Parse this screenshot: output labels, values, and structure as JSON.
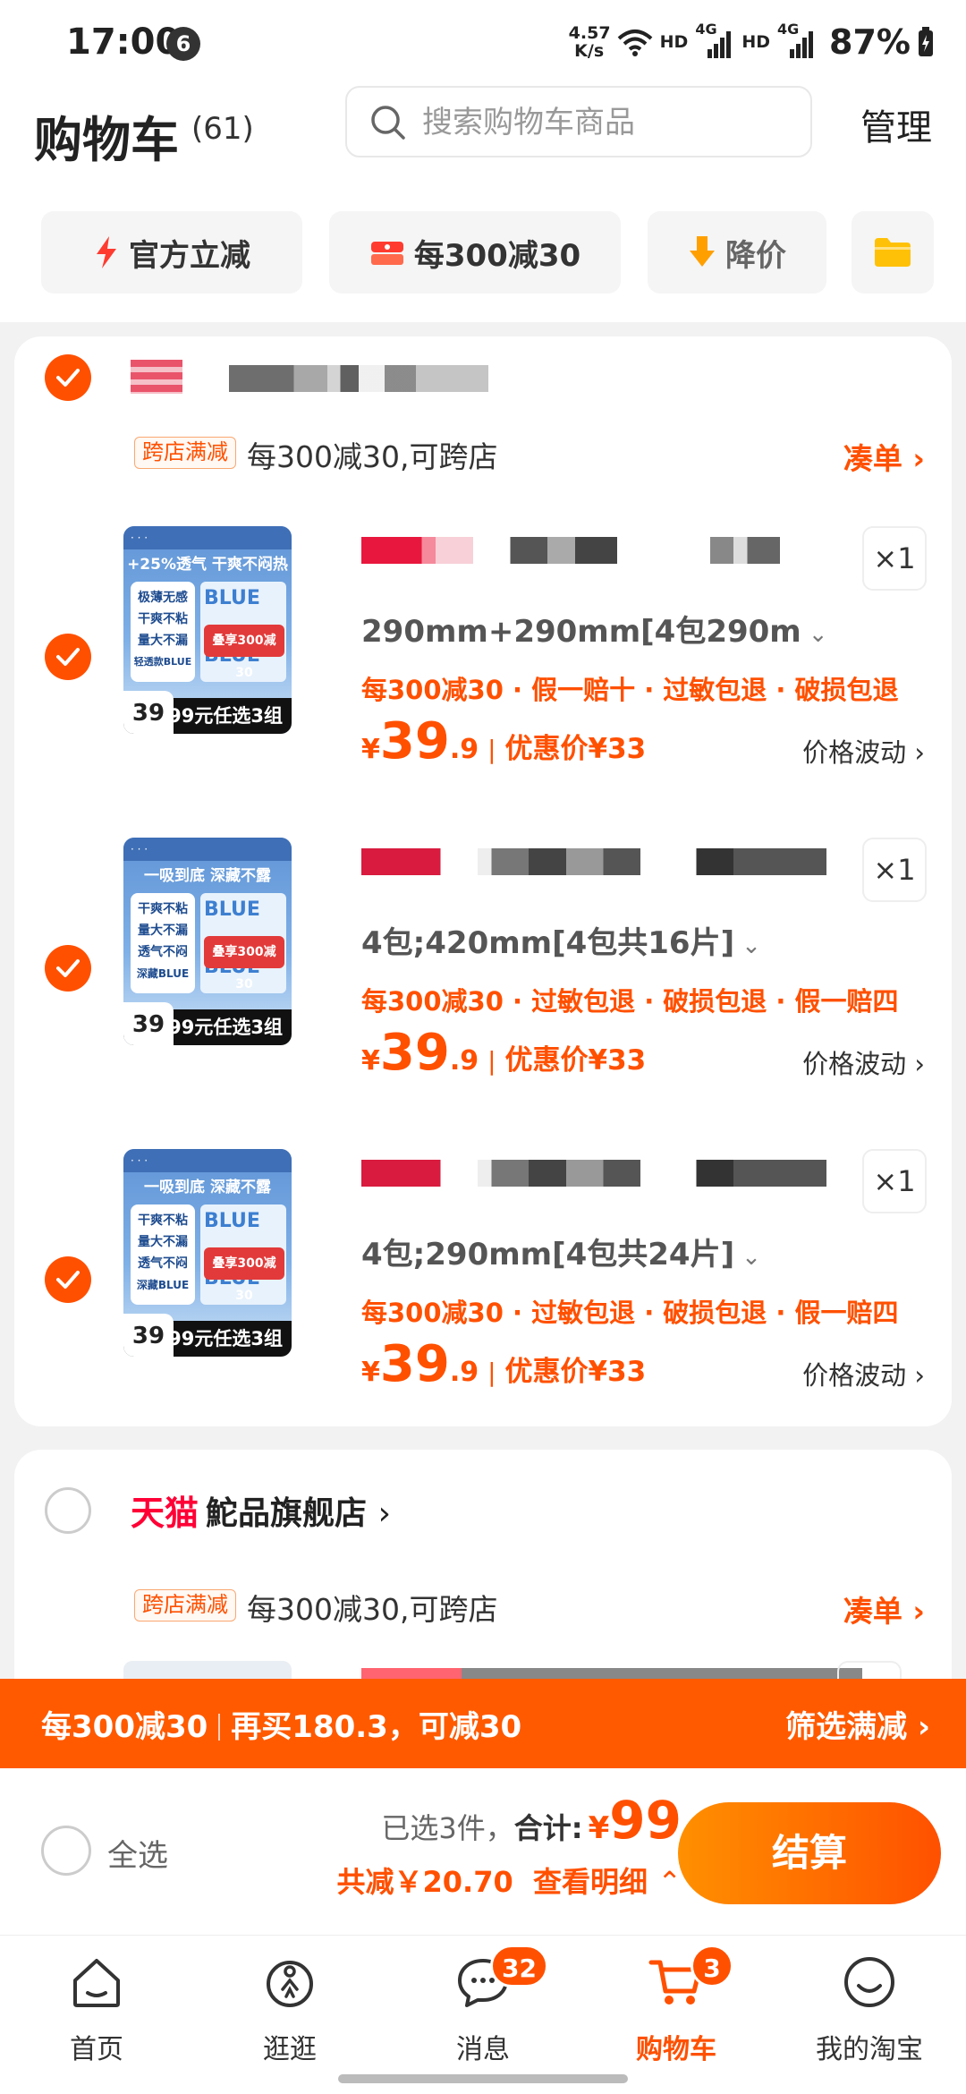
{
  "status_bar": {
    "time": "17:00",
    "notif_count": "6",
    "net_speed_value": "4.57",
    "net_speed_unit": "K/s",
    "hd1": "HD",
    "sig1": "4G",
    "hd2": "HD",
    "sig2": "4G",
    "battery": "87%"
  },
  "header": {
    "title": "购物车",
    "count": "(61)",
    "search_placeholder": "搜索购物车商品",
    "manage": "管理"
  },
  "chips": [
    {
      "label": "官方立减"
    },
    {
      "label": "每300减30"
    },
    {
      "label": "降价"
    }
  ],
  "store1": {
    "promo_tag": "跨店满减",
    "promo_text": "每300减30,可跨店",
    "collect_link": "凑单",
    "items": [
      {
        "variant": "290mm+290mm[4包290m",
        "services": "每300减30 · 假一赔十 · 过敏包退 · 破损包退",
        "price_symbol": "¥",
        "price_int": "39",
        "price_dec": ".9",
        "discount": "优惠价¥33",
        "qty": "×1",
        "price_trend": "价格波动",
        "thumb": {
          "top": "+25%透气 干爽不闷热",
          "side": [
            "极薄无感",
            "干爽不粘",
            "量大不漏",
            "轻透款BLUE"
          ],
          "badge": "叠享300减30",
          "bottom": "99元任选3组",
          "price": "39"
        }
      },
      {
        "variant": "4包;420mm[4包共16片]",
        "services": "每300减30 · 过敏包退 · 破损包退 · 假一赔四",
        "price_symbol": "¥",
        "price_int": "39",
        "price_dec": ".9",
        "discount": "优惠价¥33",
        "qty": "×1",
        "price_trend": "价格波动",
        "thumb": {
          "top": "一吸到底 深藏不露",
          "side": [
            "干爽不粘",
            "量大不漏",
            "透气不闷",
            "深藏BLUE"
          ],
          "badge": "叠享300减30",
          "bottom": "99元任选3组",
          "price": "39"
        }
      },
      {
        "variant": "4包;290mm[4包共24片]",
        "services": "每300减30 · 过敏包退 · 破损包退 · 假一赔四",
        "price_symbol": "¥",
        "price_int": "39",
        "price_dec": ".9",
        "discount": "优惠价¥33",
        "qty": "×1",
        "price_trend": "价格波动",
        "thumb": {
          "top": "一吸到底 深藏不露",
          "side": [
            "干爽不粘",
            "量大不漏",
            "透气不闷",
            "深藏BLUE"
          ],
          "badge": "叠享300减30",
          "bottom": "99元任选3组",
          "price": "39"
        }
      }
    ]
  },
  "store2": {
    "brand": "天猫",
    "name": "鮀品旗舰店",
    "promo_tag": "跨店满减",
    "promo_text": "每300减30,可跨店",
    "collect_link": "凑单"
  },
  "promo_bar": {
    "left_a": "每300减30",
    "left_b": "再买180.3，可减30",
    "right": "筛选满减"
  },
  "checkout": {
    "select_all": "全选",
    "selected": "已选3件，",
    "total_label": "合计:",
    "currency": "¥",
    "total": "99",
    "saved": "共减￥20.70",
    "detail": "查看明细",
    "button": "结算"
  },
  "nav": [
    {
      "label": "首页",
      "icon": "home-icon"
    },
    {
      "label": "逛逛",
      "icon": "browse-icon"
    },
    {
      "label": "消息",
      "icon": "message-icon",
      "badge": "32"
    },
    {
      "label": "购物车",
      "icon": "cart-icon",
      "badge": "3",
      "active": true
    },
    {
      "label": "我的淘宝",
      "icon": "profile-icon"
    }
  ],
  "colors": {
    "accent": "#ff5000",
    "tmall_red": "#ff0036",
    "background": "#f2f2f2"
  }
}
